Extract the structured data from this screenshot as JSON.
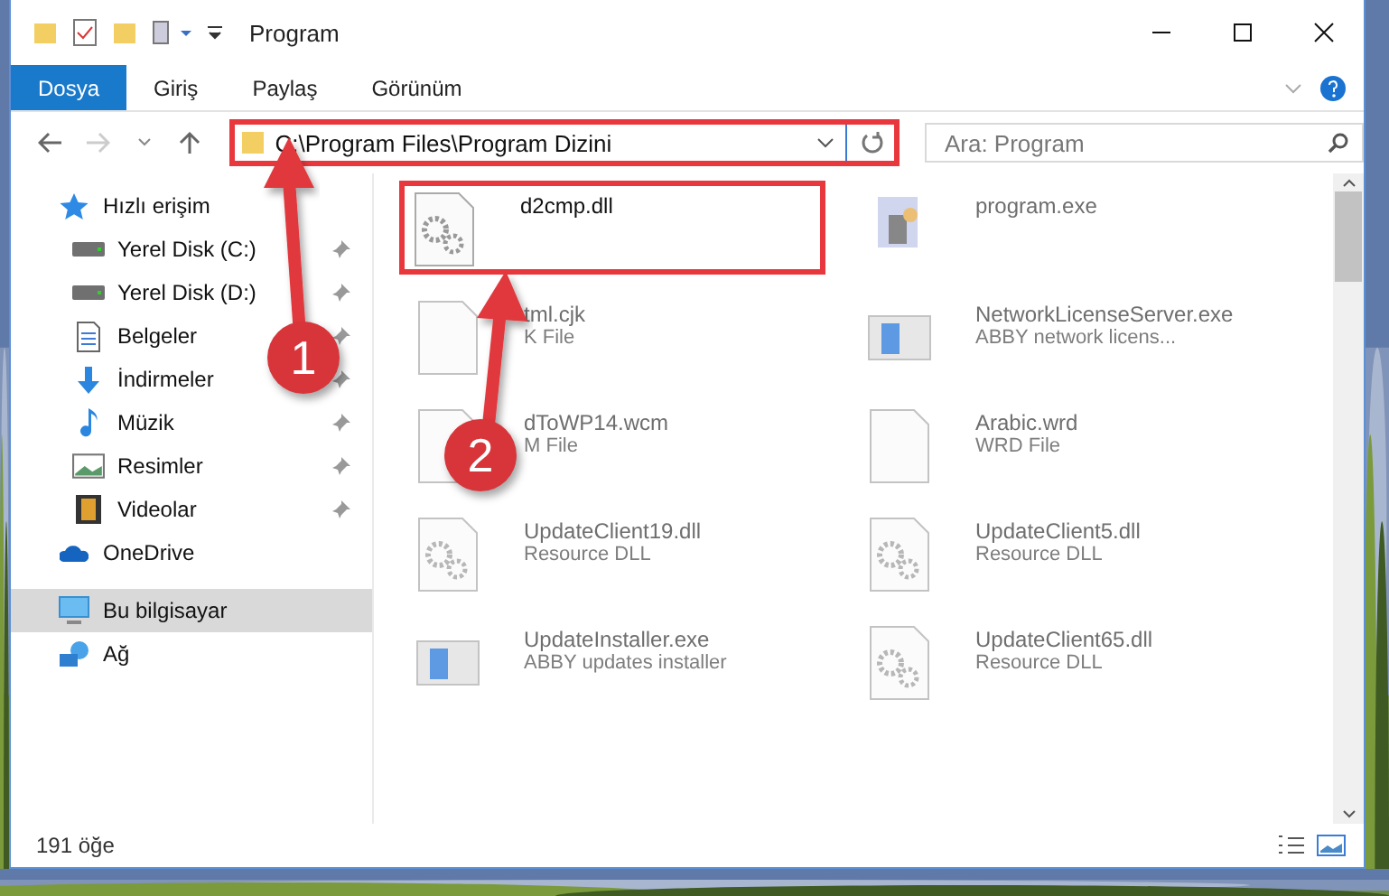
{
  "window": {
    "title": "Program"
  },
  "ribbon_tabs": [
    {
      "label": "Dosya",
      "selected": true
    },
    {
      "label": "Giriş",
      "selected": false
    },
    {
      "label": "Paylaş",
      "selected": false
    },
    {
      "label": "Görünüm",
      "selected": false
    }
  ],
  "address": {
    "value": "C:\\Program Files\\Program Dizini",
    "highlighted": true
  },
  "search": {
    "placeholder": "Ara: Program"
  },
  "sidebar": {
    "items": [
      {
        "label": "Hızlı erişim",
        "kind": "star",
        "pinned": false,
        "selected": false,
        "children": [
          {
            "label": "Yerel Disk (C:)",
            "kind": "drive",
            "pinned": true,
            "selected": false
          },
          {
            "label": "Yerel Disk (D:)",
            "kind": "drive",
            "pinned": true,
            "selected": false
          },
          {
            "label": "Belgeler",
            "kind": "document",
            "pinned": true,
            "selected": false
          },
          {
            "label": "İndirmeler",
            "kind": "download",
            "pinned": true,
            "selected": false
          },
          {
            "label": "Müzik",
            "kind": "music",
            "pinned": true,
            "selected": false
          },
          {
            "label": "Resimler",
            "pinned": true,
            "selected": false
          },
          {
            "label": "Videolar",
            "kind": "video",
            "pinned": true,
            "selected": false
          }
        ]
      },
      {
        "label": "OneDrive",
        "kind": "cloud",
        "pinned": false,
        "selected": false
      },
      {
        "label": "Bu bilgisayar",
        "kind": "computer",
        "pinned": false,
        "selected": true
      },
      {
        "label": "Ağ",
        "kind": "network",
        "pinned": false,
        "selected": false
      }
    ]
  },
  "files": [
    {
      "name": "d2cmp.dll",
      "kind": "dll",
      "highlighted": true,
      "blurred": false
    },
    {
      "name": "program.exe",
      "kind": "app",
      "highlighted": false,
      "blurred": true
    },
    {
      "name": "tml.cjk",
      "type": "K File",
      "kind": "blank",
      "highlighted": false,
      "blurred": true
    },
    {
      "name": "NetworkLicenseServer.exe",
      "type": "ABBY network licens...",
      "kind": "window",
      "highlighted": false,
      "blurred": true
    },
    {
      "name": "dToWP14.wcm",
      "type": "M File",
      "kind": "blank",
      "highlighted": false,
      "blurred": true
    },
    {
      "name": "Arabic.wrd",
      "type": "WRD File",
      "kind": "blank",
      "highlighted": false,
      "blurred": true
    },
    {
      "name": "UpdateClient19.dll",
      "type": "Resource DLL",
      "kind": "dll",
      "highlighted": false,
      "blurred": true
    },
    {
      "name": "UpdateClient5.dll",
      "type": "Resource DLL",
      "kind": "dll",
      "highlighted": false,
      "blurred": true
    },
    {
      "name": "UpdateInstaller.exe",
      "type": "ABBY updates installer",
      "kind": "window",
      "highlighted": false,
      "blurred": true
    },
    {
      "name": "UpdateClient65.dll",
      "type": "Resource DLL",
      "kind": "dll",
      "highlighted": false,
      "blurred": true
    }
  ],
  "status_bar": {
    "count": "191 öğe"
  },
  "annotations": [
    {
      "number": "1"
    },
    {
      "number": "2"
    }
  ]
}
